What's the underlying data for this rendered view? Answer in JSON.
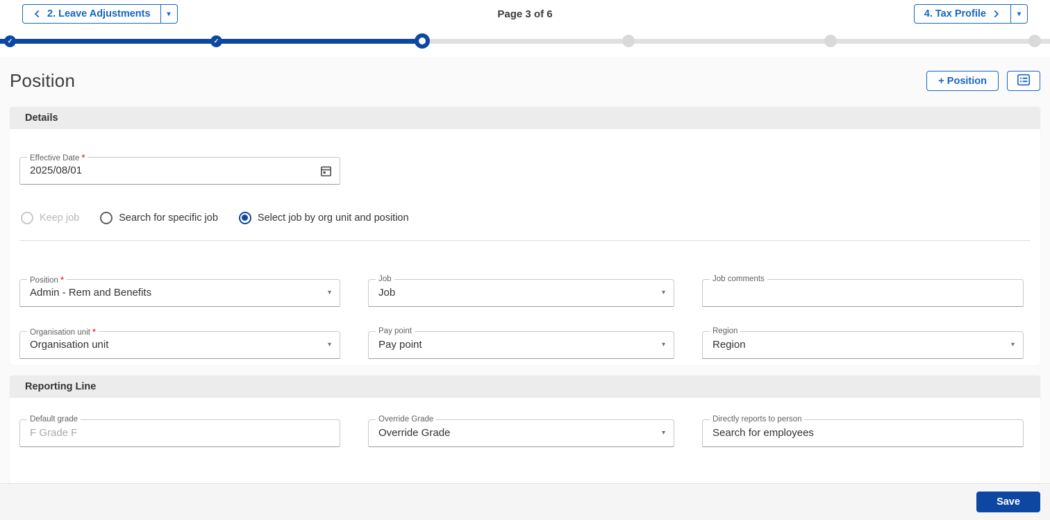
{
  "nav": {
    "prev_label": "2. Leave Adjustments",
    "page_indicator": "Page 3 of 6",
    "next_label": "4. Tax Profile"
  },
  "stepper": {
    "current_step": 3,
    "total_steps": 6
  },
  "page": {
    "title": "Position"
  },
  "toolbar": {
    "add_position_label": "+ Position"
  },
  "sections": {
    "details": {
      "header": "Details",
      "effective_date": {
        "label": "Effective Date",
        "required": true,
        "value": "2025/08/01"
      },
      "job_mode_options": [
        {
          "label": "Keep job",
          "state": "disabled"
        },
        {
          "label": "Search for specific job",
          "state": "enabled"
        },
        {
          "label": "Select job by org unit and position",
          "state": "selected"
        }
      ],
      "fields": {
        "position": {
          "label": "Position",
          "required": true,
          "value": "Admin - Rem and Benefits"
        },
        "job": {
          "label": "Job",
          "value": "Job"
        },
        "job_comments": {
          "label": "Job comments",
          "value": ""
        },
        "organisation_unit": {
          "label": "Organisation unit",
          "required": true,
          "value": "Organisation unit"
        },
        "pay_point": {
          "label": "Pay point",
          "value": "Pay point"
        },
        "region": {
          "label": "Region",
          "value": "Region"
        }
      }
    },
    "reporting_line": {
      "header": "Reporting Line",
      "fields": {
        "default_grade": {
          "label": "Default grade",
          "value": "F Grade F",
          "disabled": true
        },
        "override_grade": {
          "label": "Override Grade",
          "value": "Override Grade"
        },
        "directly_reports_to_person": {
          "label": "Directly reports to person",
          "value": "Search for employees"
        }
      }
    }
  },
  "footer": {
    "save_label": "Save"
  },
  "ui": {
    "required_marker": "*"
  },
  "icons": {
    "check": "✓",
    "caret_down": "▾",
    "chevron_left": "chevron-left-icon",
    "chevron_right": "chevron-right-icon",
    "calendar": "calendar-icon",
    "list_alt": "list-alt-icon"
  },
  "colors": {
    "primary": "#0d47a1",
    "primary_light": "#1565c0",
    "required_red": "#e53935",
    "track_gray": "#e0e0e0",
    "section_header_bg": "#ececec",
    "footer_bg": "#f5f5f6",
    "field_border": "#c9c9c9",
    "disabled_text": "#a9a9a9"
  }
}
